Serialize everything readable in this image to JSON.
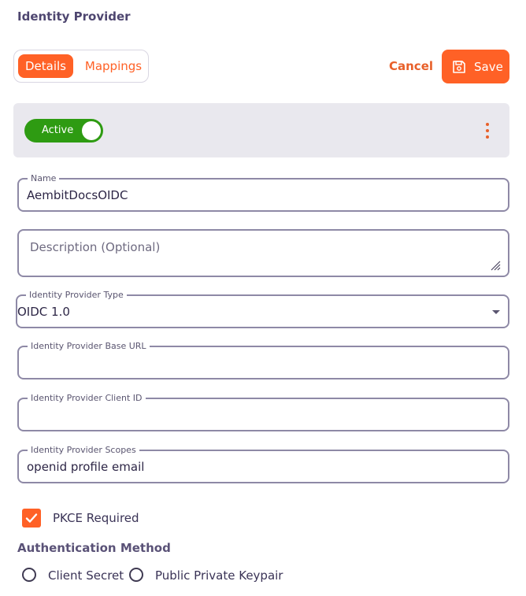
{
  "page": {
    "title": "Identity Provider"
  },
  "tabs": [
    {
      "label": "Details",
      "active": true
    },
    {
      "label": "Mappings",
      "active": false
    }
  ],
  "actions": {
    "cancel_label": "Cancel",
    "save_label": "Save",
    "save_icon": "save-icon"
  },
  "status": {
    "toggle_label": "Active",
    "toggle_on": true,
    "menu_icon": "more-vertical-icon"
  },
  "form": {
    "name": {
      "label": "Name",
      "value": "AembitDocsOIDC"
    },
    "description": {
      "placeholder": "Description (Optional)",
      "value": ""
    },
    "provider_type": {
      "label": "Identity Provider Type",
      "value": "OIDC 1.0"
    },
    "base_url": {
      "label": "Identity Provider Base URL",
      "value": ""
    },
    "client_id": {
      "label": "Identity Provider Client ID",
      "value": ""
    },
    "scopes": {
      "label": "Identity Provider Scopes",
      "value": "openid profile email"
    },
    "pkce": {
      "label": "PKCE Required",
      "checked": true
    },
    "auth_method": {
      "heading": "Authentication Method",
      "options": [
        {
          "label": "Client Secret",
          "selected": false
        },
        {
          "label": "Public Private Keypair",
          "selected": false
        }
      ]
    }
  },
  "colors": {
    "accent": "#ff6126",
    "toggle_on": "#2e9b12",
    "field_border": "#8e89a6",
    "status_bar_bg": "#e9e8ee"
  }
}
